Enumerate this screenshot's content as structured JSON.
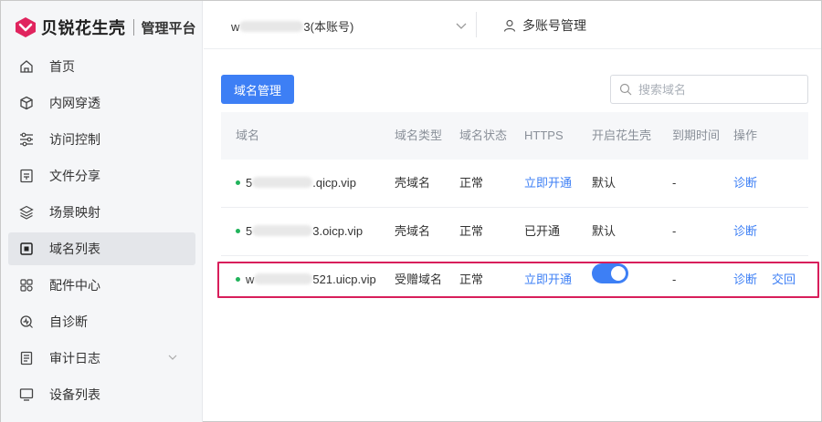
{
  "brand": {
    "name": "贝锐花生壳",
    "sub": "管理平台",
    "accent": "#e0245e"
  },
  "sidebar": {
    "items": [
      {
        "label": "首页",
        "icon": "home-icon"
      },
      {
        "label": "内网穿透",
        "icon": "cube-icon"
      },
      {
        "label": "访问控制",
        "icon": "sliders-icon"
      },
      {
        "label": "文件分享",
        "icon": "file-share-icon"
      },
      {
        "label": "场景映射",
        "icon": "scene-icon"
      },
      {
        "label": "域名列表",
        "icon": "domain-list-icon",
        "active": true
      },
      {
        "label": "配件中心",
        "icon": "grid-icon"
      },
      {
        "label": "自诊断",
        "icon": "diagnose-icon"
      },
      {
        "label": "审计日志",
        "icon": "log-icon",
        "expandable": true
      },
      {
        "label": "设备列表",
        "icon": "monitor-icon"
      }
    ]
  },
  "header": {
    "account_prefix": "w",
    "account_suffix": "3(本账号)",
    "multi_account": "多账号管理"
  },
  "toolbar": {
    "domain_manage": "域名管理"
  },
  "search": {
    "placeholder": "搜索域名"
  },
  "table": {
    "headers": {
      "domain": "域名",
      "type": "域名类型",
      "status": "域名状态",
      "https": "HTTPS",
      "enable": "开启花生壳",
      "expire": "到期时间",
      "ops": "操作"
    },
    "rows": [
      {
        "domain_prefix": "5",
        "domain_suffix": ".qicp.vip",
        "type": "壳域名",
        "status": "正常",
        "https": "立即开通",
        "https_link": true,
        "enable": "默认",
        "expire": "-",
        "op1": "诊断",
        "op2": ""
      },
      {
        "domain_prefix": "5",
        "domain_suffix": "3.oicp.vip",
        "type": "壳域名",
        "status": "正常",
        "https": "已开通",
        "https_link": false,
        "enable": "默认",
        "expire": "-",
        "op1": "诊断",
        "op2": ""
      },
      {
        "domain_prefix": "w",
        "domain_suffix": "521.uicp.vip",
        "type": "受赠域名",
        "status": "正常",
        "https": "立即开通",
        "https_link": true,
        "enable_toggle": true,
        "expire": "-",
        "op1": "诊断",
        "op2": "交回"
      }
    ]
  },
  "colors": {
    "primary": "#3d7ff5",
    "highlight": "#d81e5b",
    "online": "#21b35b"
  }
}
